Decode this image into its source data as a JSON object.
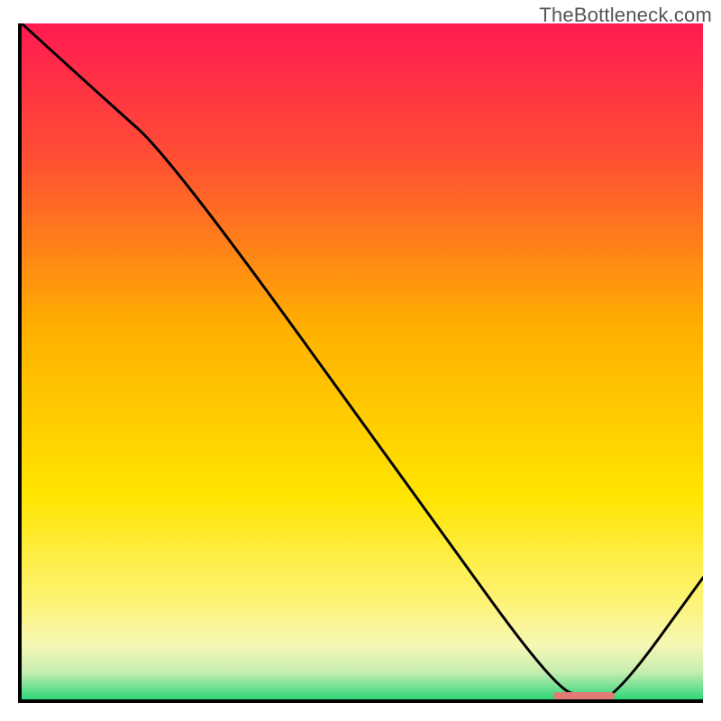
{
  "attribution": "TheBottleneck.com",
  "chart_data": {
    "type": "line",
    "title": "",
    "xlabel": "",
    "ylabel": "",
    "xlim": [
      0,
      100
    ],
    "ylim": [
      0,
      100
    ],
    "x": [
      0,
      12,
      22,
      60,
      78,
      83,
      87,
      100
    ],
    "values": [
      100,
      89,
      80,
      27,
      2,
      0,
      0,
      18
    ],
    "annotation": {
      "x_start": 78,
      "x_end": 87,
      "y": 0
    },
    "background_gradient_stops": [
      {
        "offset": 0.0,
        "color": "#ff1a52"
      },
      {
        "offset": 0.2,
        "color": "#ff4f33"
      },
      {
        "offset": 0.45,
        "color": "#ffb000"
      },
      {
        "offset": 0.7,
        "color": "#ffe500"
      },
      {
        "offset": 0.86,
        "color": "#fdf47a"
      },
      {
        "offset": 0.92,
        "color": "#f6f7b5"
      },
      {
        "offset": 0.96,
        "color": "#c5edb0"
      },
      {
        "offset": 1.0,
        "color": "#2fd67a"
      }
    ]
  }
}
